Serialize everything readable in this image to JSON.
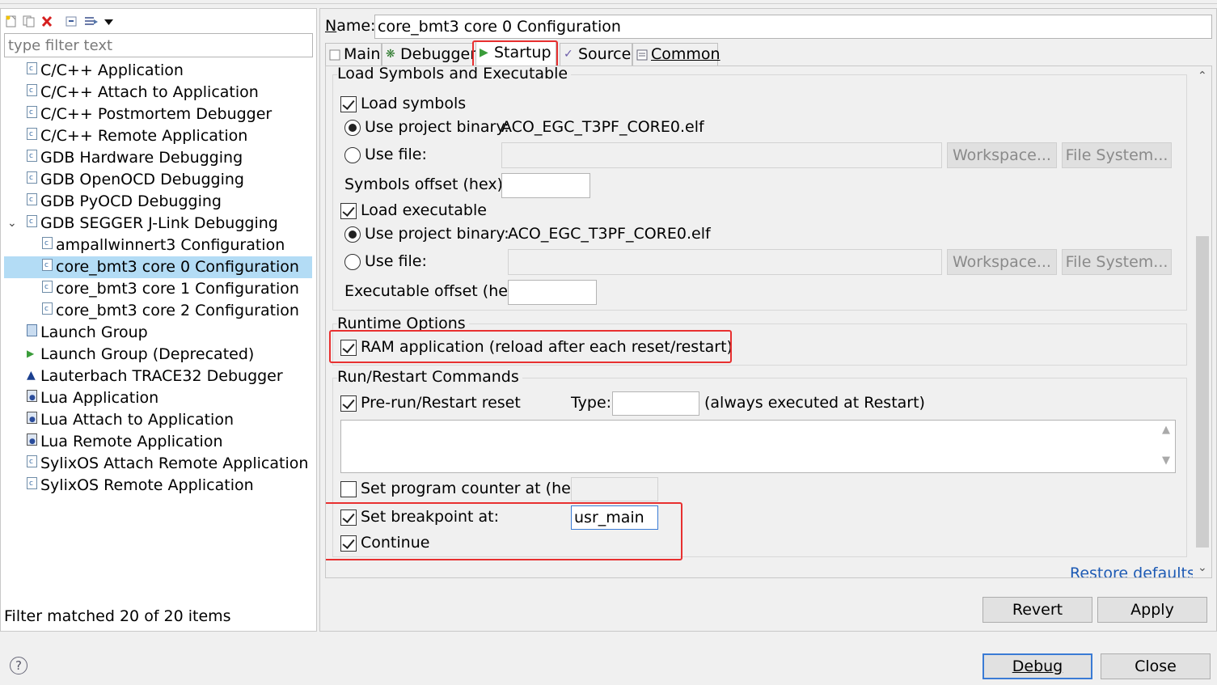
{
  "left": {
    "filter_placeholder": "type filter text",
    "tree": [
      {
        "label": "C/C++ Application",
        "icon": "c-file-icon"
      },
      {
        "label": "C/C++ Attach to Application",
        "icon": "c-file-icon"
      },
      {
        "label": "C/C++ Postmortem Debugger",
        "icon": "c-file-icon"
      },
      {
        "label": "C/C++ Remote Application",
        "icon": "c-file-icon"
      },
      {
        "label": "GDB Hardware Debugging",
        "icon": "c-file-icon"
      },
      {
        "label": "GDB OpenOCD Debugging",
        "icon": "c-file-icon"
      },
      {
        "label": "GDB PyOCD Debugging",
        "icon": "c-file-icon"
      },
      {
        "label": "GDB SEGGER J-Link Debugging",
        "icon": "c-file-icon",
        "expanded": true
      },
      {
        "label": "ampallwinnert3 Configuration",
        "icon": "c-file-icon"
      },
      {
        "label": "core_bmt3 core 0 Configuration",
        "icon": "c-file-icon",
        "selected": true
      },
      {
        "label": "core_bmt3 core 1 Configuration",
        "icon": "c-file-icon"
      },
      {
        "label": "core_bmt3 core 2 Configuration",
        "icon": "c-file-icon"
      },
      {
        "label": "Launch Group",
        "icon": "launch-group-icon"
      },
      {
        "label": "Launch Group (Deprecated)",
        "icon": "run-icon"
      },
      {
        "label": "Lauterbach TRACE32 Debugger",
        "icon": "lauterbach-icon"
      },
      {
        "label": "Lua Application",
        "icon": "lua-icon"
      },
      {
        "label": "Lua Attach to Application",
        "icon": "lua-icon"
      },
      {
        "label": "Lua Remote Application",
        "icon": "lua-icon"
      },
      {
        "label": "SylixOS Attach Remote Application",
        "icon": "c-file-icon"
      },
      {
        "label": "SylixOS Remote Application",
        "icon": "c-file-icon"
      }
    ],
    "filter_status": "Filter matched 20 of 20 items"
  },
  "right": {
    "name_label": "Name:",
    "name_value": "core_bmt3 core 0 Configuration",
    "tabs": [
      {
        "label": "Main",
        "icon": "main-icon"
      },
      {
        "label": "Debugger",
        "icon": "debugger-icon"
      },
      {
        "label": "Startup",
        "icon": "run-icon",
        "active": true
      },
      {
        "label": "Source",
        "icon": "source-icon"
      },
      {
        "label": "Common",
        "icon": "common-icon"
      }
    ],
    "load_group": {
      "title": "Load Symbols and Executable",
      "load_symbols": "Load symbols",
      "use_project_binary": "Use project binary:",
      "symbols_binary": "ACO_EGC_T3PF_CORE0.elf",
      "use_file": "Use file:",
      "workspace_btn": "Workspace...",
      "filesystem_btn": "File System...",
      "symbols_offset": "Symbols offset (hex):",
      "load_executable": "Load executable",
      "exec_binary": "ACO_EGC_T3PF_CORE0.elf",
      "exec_offset": "Executable offset (hex):"
    },
    "runtime_group": {
      "title": "Runtime Options",
      "ram_app": "RAM application (reload after each reset/restart)"
    },
    "run_group": {
      "title": "Run/Restart Commands",
      "prerun": "Pre-run/Restart reset",
      "type_label": "Type:",
      "type_note": "(always executed at Restart)",
      "set_pc": "Set program counter at (hex):",
      "set_breakpoint": "Set breakpoint at:",
      "breakpoint_value": "usr_main",
      "continue": "Continue"
    },
    "restore_defaults": "Restore defaults",
    "revert": "Revert",
    "apply": "Apply"
  },
  "footer": {
    "debug": "Debug",
    "close": "Close"
  },
  "colors": {
    "selection": "#b3dcf5",
    "highlight_box": "#e83030",
    "link": "#1d5ab4"
  }
}
